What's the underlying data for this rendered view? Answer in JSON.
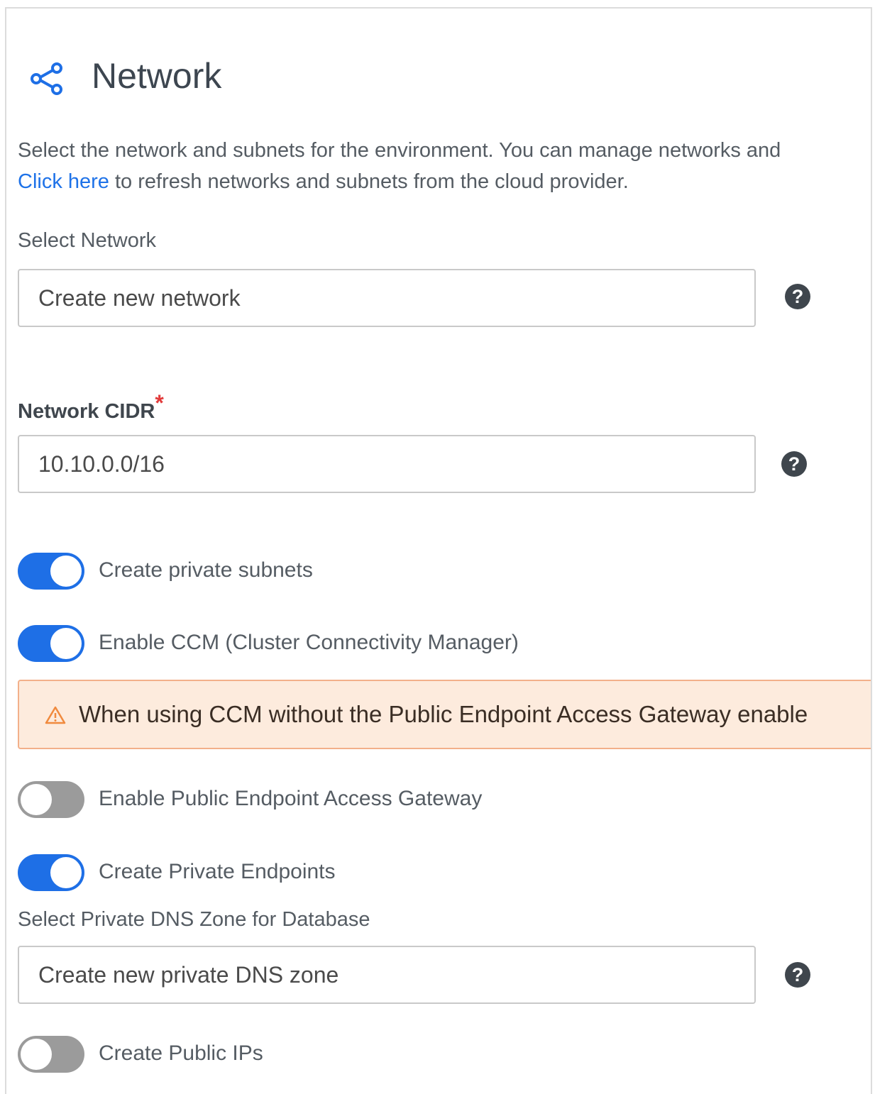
{
  "header": {
    "icon": "share-network-icon",
    "title": "Network"
  },
  "description": {
    "line1": "Select the network and subnets for the environment. You can manage networks and",
    "link": "Click here",
    "line2_rest": " to refresh networks and subnets from the cloud provider."
  },
  "select_network": {
    "label": "Select Network",
    "value": "Create new network"
  },
  "network_cidr": {
    "label": "Network CIDR",
    "required_mark": "*",
    "value": "10.10.0.0/16"
  },
  "toggles": {
    "private_subnets": {
      "label": "Create private subnets",
      "on": true
    },
    "enable_ccm": {
      "label": "Enable CCM (Cluster Connectivity Manager)",
      "on": true
    },
    "public_endpoint_gateway": {
      "label": "Enable Public Endpoint Access Gateway",
      "on": false
    },
    "private_endpoints": {
      "label": "Create Private Endpoints",
      "on": true
    },
    "public_ips": {
      "label": "Create Public IPs",
      "on": false
    }
  },
  "warning": {
    "icon": "warning-triangle-icon",
    "text": "When using CCM without the Public Endpoint Access Gateway enable"
  },
  "private_dns": {
    "label": "Select Private DNS Zone for Database",
    "value": "Create new private DNS zone"
  },
  "help_glyph": "?",
  "colors": {
    "accent": "#1e6fe6",
    "link": "#1e72e8",
    "toggle_off": "#9b9b9b",
    "warning_bg": "#fdebdd",
    "warning_border": "#f3b08a",
    "required": "#e23b3b"
  }
}
